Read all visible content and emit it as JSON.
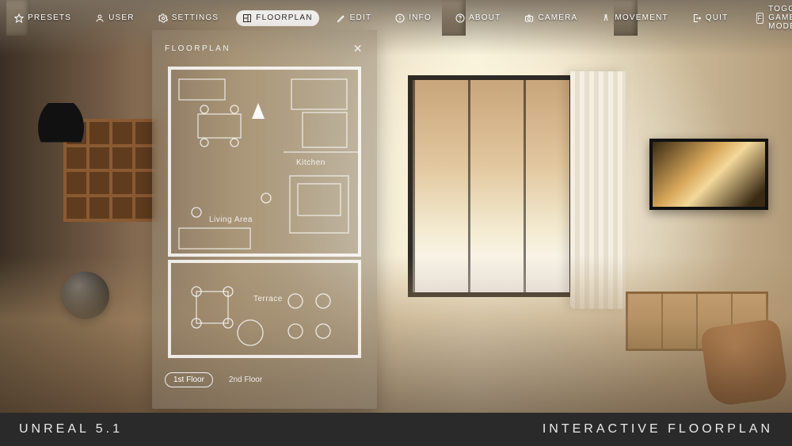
{
  "menu": {
    "presets": "PRESETS",
    "user": "USER",
    "settings": "SETTINGS",
    "floorplan": "FLOORPLAN",
    "edit": "EDIT",
    "info": "INFO",
    "about": "ABOUT",
    "camera": "CAMERA",
    "movement": "MOVEMENT",
    "quit": "QUIT",
    "active": "floorplan"
  },
  "toggle": {
    "key": "F",
    "label": "TOGGLE GAME MODE"
  },
  "panel": {
    "title": "FLOORPLAN",
    "rooms": {
      "kitchen": "Kitchen",
      "living": "Living Area",
      "terrace": "Terrace"
    },
    "floors": {
      "first": "1st Floor",
      "second": "2nd Floor",
      "active": "first"
    }
  },
  "footer": {
    "engine": "UNREAL 5.1",
    "title": "INTERACTIVE FLOORPLAN"
  }
}
